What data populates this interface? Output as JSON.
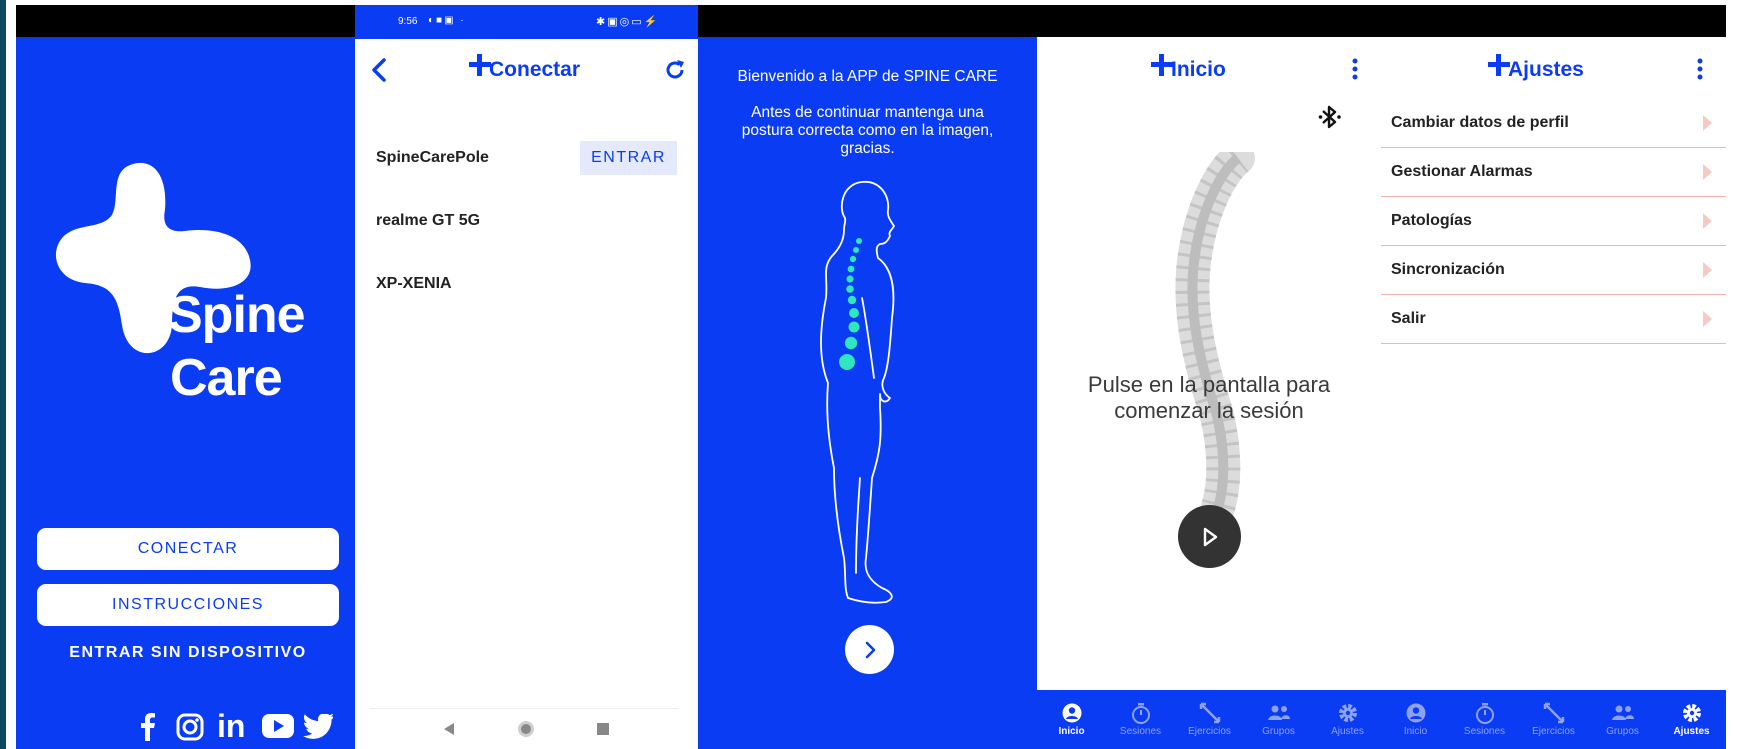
{
  "colors": {
    "brand_blue": "#0a3cf4",
    "accent_teal": "#2ee6c0",
    "divider_pink": "#f4b3ad"
  },
  "splash": {
    "logo_line1": "Spine",
    "logo_line2": "Care",
    "connect_button": "CONECTAR",
    "instructions_button": "INSTRUCCIONES",
    "no_device_link": "ENTRAR SIN DISPOSITIVO",
    "social_icons": [
      "facebook-icon",
      "instagram-icon",
      "linkedin-icon",
      "youtube-icon",
      "twitter-icon"
    ]
  },
  "connect": {
    "status_time": "9:56",
    "title": "Conectar",
    "devices": [
      {
        "name": "SpineCarePole",
        "action": "ENTRAR"
      },
      {
        "name": "realme GT 5G"
      },
      {
        "name": "XP-XENIA"
      }
    ]
  },
  "welcome": {
    "line1": "Bienvenido a la APP de SPINE CARE",
    "line2": "Antes de continuar mantenga una",
    "line3": "postura correcta como en la imagen,",
    "line4": "gracias."
  },
  "home": {
    "title": "Inicio",
    "prompt_line1": "Pulse en la pantalla para",
    "prompt_line2": "comenzar la sesión"
  },
  "settings": {
    "title": "Ajustes",
    "items": [
      "Cambiar datos de perfil",
      "Gestionar Alarmas",
      "Patologías",
      "Sincronización",
      "Salir"
    ]
  },
  "nav_left": {
    "items": [
      "Inicio",
      "Sesiones",
      "Ejercicios",
      "Grupos",
      "Ajustes"
    ],
    "active": "Inicio"
  },
  "nav_right": {
    "items": [
      "Inicio",
      "Sesiones",
      "Ejercicios",
      "Grupos",
      "Ajustes"
    ],
    "active": "Ajustes"
  }
}
